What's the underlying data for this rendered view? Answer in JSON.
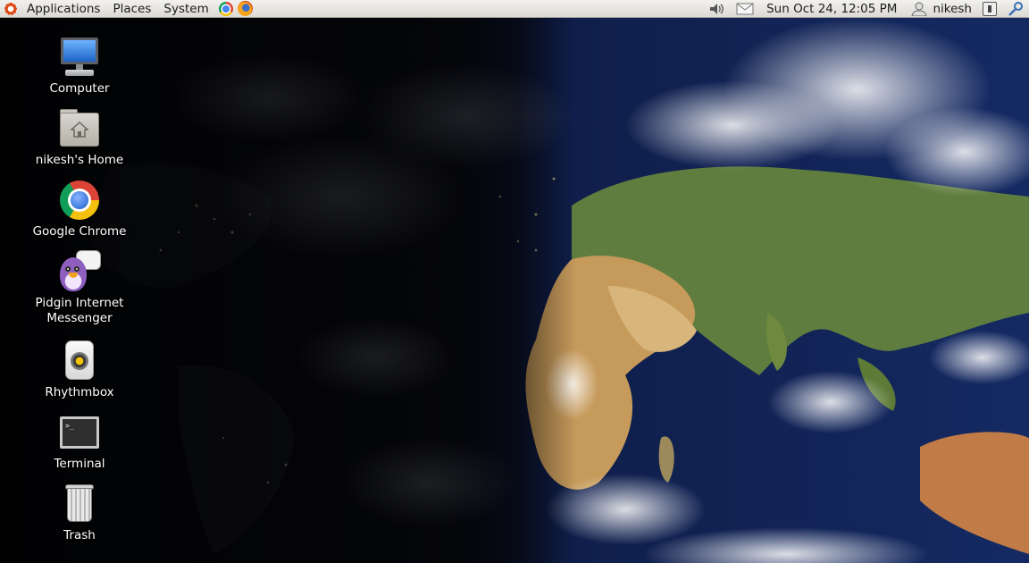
{
  "panel": {
    "menus": [
      "Applications",
      "Places",
      "System"
    ],
    "launchers": [
      "chrome-icon",
      "firefox-icon"
    ],
    "clock": "Sun Oct 24, 12:05 PM",
    "user": "nikesh",
    "tray_icons": [
      "volume-icon",
      "mail-icon",
      "user-icon",
      "session-icon",
      "accessibility-icon"
    ]
  },
  "desktop": {
    "icons": [
      {
        "label": "Computer",
        "icon": "computer-icon"
      },
      {
        "label": "nikesh's Home",
        "icon": "home-folder-icon"
      },
      {
        "label": "Google Chrome",
        "icon": "chrome-icon"
      },
      {
        "label": "Pidgin Internet Messenger",
        "icon": "pidgin-icon"
      },
      {
        "label": "Rhythmbox",
        "icon": "rhythmbox-icon"
      },
      {
        "label": "Terminal",
        "icon": "terminal-icon"
      },
      {
        "label": "Trash",
        "icon": "trash-icon"
      }
    ],
    "wallpaper": "earth-day-night-map",
    "colors": {
      "ocean": "#0f1f4a",
      "night": "#0a0c14",
      "desert": "#c79a5a",
      "land": "#4f7a3a"
    }
  }
}
